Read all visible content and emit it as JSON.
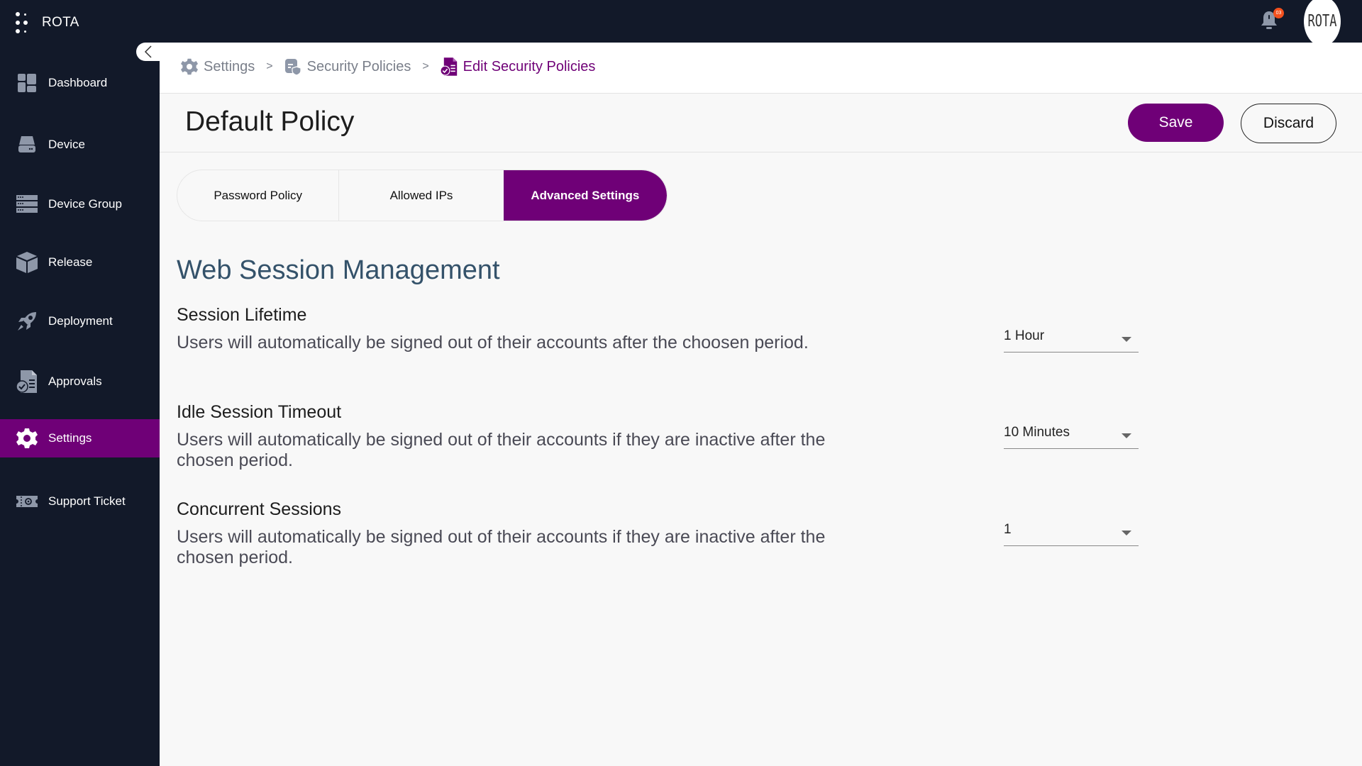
{
  "app": {
    "brand": "ROTA",
    "notification_count": "03",
    "avatar_text": "ROTA",
    "accent_color": "#6f0077"
  },
  "sidebar": {
    "items": [
      {
        "label": "Dashboard",
        "icon": "dashboard-icon"
      },
      {
        "label": "Device",
        "icon": "device-icon"
      },
      {
        "label": "Device Group",
        "icon": "device-group-icon"
      },
      {
        "label": "Release",
        "icon": "release-icon"
      },
      {
        "label": "Deployment",
        "icon": "rocket-icon"
      },
      {
        "label": "Approvals",
        "icon": "approvals-icon"
      },
      {
        "label": "Settings",
        "icon": "gear-icon",
        "active": true
      },
      {
        "label": "Support Ticket",
        "icon": "ticket-icon"
      }
    ]
  },
  "breadcrumb": [
    {
      "label": "Settings",
      "icon": "gear-icon"
    },
    {
      "label": "Security Policies",
      "icon": "security-policy-icon"
    },
    {
      "label": "Edit Security Policies",
      "icon": "edit-policy-icon"
    }
  ],
  "header": {
    "title": "Default Policy",
    "save_label": "Save",
    "discard_label": "Discard"
  },
  "tabs": [
    {
      "label": "Password Policy"
    },
    {
      "label": "Allowed IPs"
    },
    {
      "label": "Advanced Settings",
      "active": true
    }
  ],
  "section": {
    "title": "Web Session Management",
    "settings": [
      {
        "label": "Session Lifetime",
        "description": "Users will automatically be signed out of their accounts after the choosen period.",
        "value": "1 Hour"
      },
      {
        "label": "Idle Session Timeout",
        "description": "Users will automatically be signed out of their accounts if they are inactive after the chosen period.",
        "value": "10 Minutes"
      },
      {
        "label": "Concurrent Sessions",
        "description": "Users will automatically be signed out of their accounts if they are inactive after the chosen period.",
        "value": "1"
      }
    ]
  }
}
